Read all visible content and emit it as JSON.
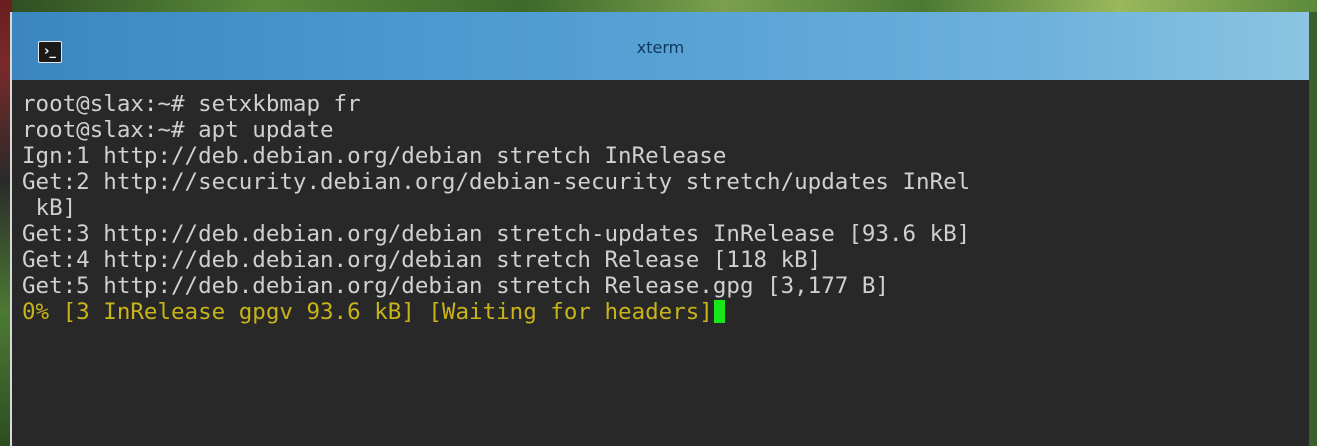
{
  "window": {
    "title": "xterm",
    "icon": "terminal-prompt-icon",
    "icon_glyph": "›_"
  },
  "terminal": {
    "lines": [
      "root@slax:~# setxkbmap fr",
      "root@slax:~# apt update",
      "Ign:1 http://deb.debian.org/debian stretch InRelease",
      "Get:2 http://security.debian.org/debian-security stretch/updates InRel",
      " kB]",
      "Get:3 http://deb.debian.org/debian stretch-updates InRelease [93.6 kB]",
      "Get:4 http://deb.debian.org/debian stretch Release [118 kB]",
      "Get:5 http://deb.debian.org/debian stretch Release.gpg [3,177 B]"
    ],
    "progress_line": "0% [3 InRelease gpgv 93.6 kB] [Waiting for headers]"
  },
  "colors": {
    "terminal_bg": "#282828",
    "text": "#d0d0d0",
    "progress_text": "#c8b418",
    "cursor": "#19e619",
    "titlebar_accent": "#4a98d0"
  }
}
